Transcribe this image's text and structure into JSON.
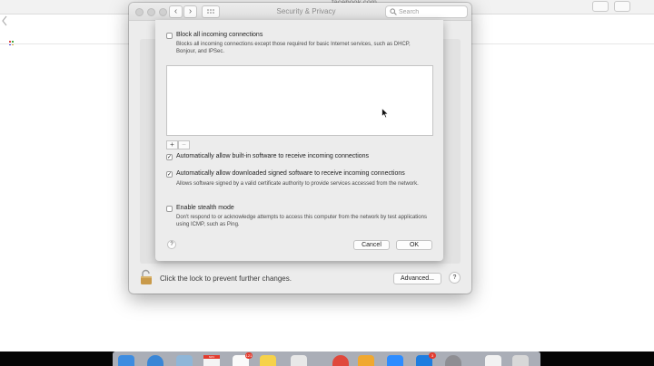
{
  "browser": {
    "url": "facebook.com"
  },
  "window": {
    "title": "Security & Privacy",
    "search_placeholder": "Search",
    "nav_back": "‹",
    "nav_forward": "›",
    "grid_glyph": "⋯",
    "lock_label": "Click the lock to prevent further changes.",
    "advanced_label": "Advanced...",
    "help_label": "?"
  },
  "firewall": {
    "block_all": {
      "label": "Block all incoming connections",
      "checked": false,
      "description": "Blocks all incoming connections except those required for basic Internet services, such as DHCP, Bonjour, and IPSec."
    },
    "plus_label": "+",
    "minus_label": "−",
    "builtin": {
      "label": "Automatically allow built-in software to receive incoming connections",
      "checked": true
    },
    "signed": {
      "label": "Automatically allow downloaded signed software to receive incoming connections",
      "checked": true,
      "description": "Allows software signed by a valid certificate authority to provide services accessed from the network."
    },
    "stealth": {
      "label": "Enable stealth mode",
      "checked": false,
      "description": "Don't respond to or acknowledge attempts to access this computer from the network by test applications using ICMP, such as Ping."
    },
    "checkmark": "✓",
    "help_label": "?",
    "cancel_label": "Cancel",
    "ok_label": "OK"
  },
  "dock": {
    "calendar_month": "NOV",
    "badges": [
      "121",
      "3"
    ],
    "icon_colors": {
      "finder": "#3d8ce0",
      "safari": "#3a86d6",
      "calendar": "#f4f4f4",
      "reminders": "#fafafa",
      "notes": "#f6d24a",
      "slack": "#e8e8e8",
      "chrome": "#e0483c",
      "photos": "#f0a830",
      "zoom": "#2d8cff",
      "xcode": "#1e7de0",
      "settings": "#8e8e93",
      "trash": "#d8d8d8"
    }
  }
}
